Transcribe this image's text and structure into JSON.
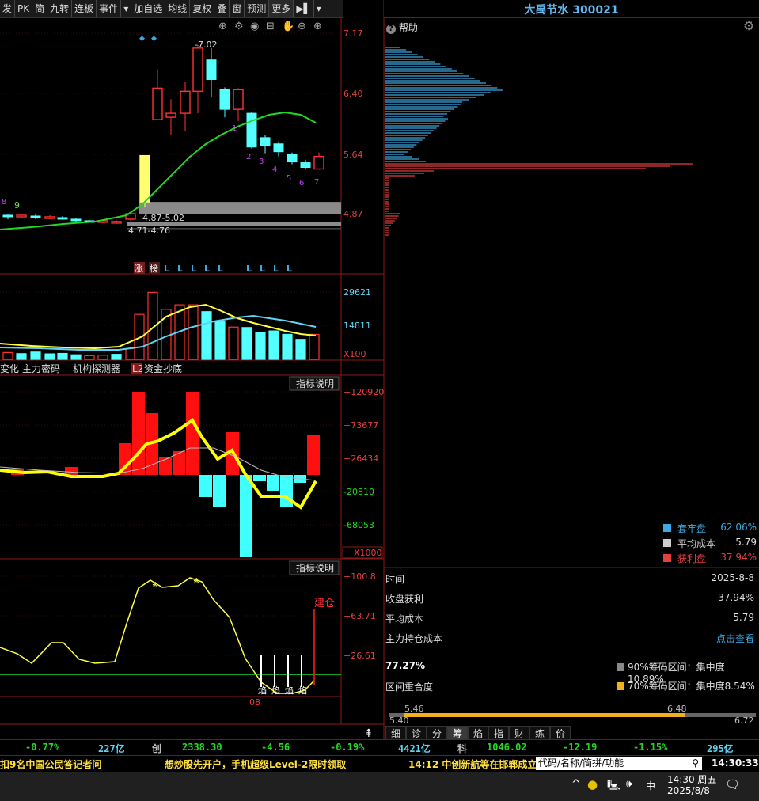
{
  "toolbar": {
    "items": [
      "发",
      "PK",
      "简",
      "九转",
      "连板",
      "事件",
      "▾",
      "加自选",
      "均线",
      "复权",
      "叠",
      "窗",
      "预测",
      "更多",
      "▶▌",
      "▾"
    ]
  },
  "stock": {
    "title": "大禹节水 300021",
    "help": "帮助"
  },
  "price_panel": {
    "y_ticks": [
      "7.17",
      "6.40",
      "5.64",
      "4.87"
    ],
    "high_label": "7.02",
    "zone1": "4.87-5.02",
    "zone2": "4.71-4.76",
    "counts": [
      "1",
      "2",
      "3",
      "4",
      "5",
      "6",
      "7"
    ],
    "left_labels": [
      "8",
      "9"
    ],
    "events": [
      "涨",
      "榜",
      "L",
      "L",
      "L",
      "L",
      "L",
      "L",
      "L",
      "L",
      "L"
    ]
  },
  "volume_panel": {
    "y_ticks": [
      "29621",
      "14811"
    ],
    "unit": "X100"
  },
  "indicator_tabs": [
    "变化",
    "主力密码",
    "机构探测器",
    "L2",
    "资金抄底"
  ],
  "macd_panel": {
    "button": "指标说明",
    "y_ticks": [
      "+120920",
      "+73677",
      "+26434",
      "-20810",
      "-68053"
    ],
    "unit": "X1000"
  },
  "osc_panel": {
    "button": "指标说明",
    "y_ticks": [
      "+100.8",
      "+63.71",
      "+26.61"
    ],
    "label": "建仓",
    "glyph": "焰",
    "date": "08"
  },
  "chip_dist": {
    "legend": [
      {
        "name": "套牢盘",
        "value": "62.06%",
        "color": "#3fa8e0"
      },
      {
        "name": "平均成本",
        "value": "5.79",
        "color": "#cccccc"
      },
      {
        "name": "获利盘",
        "value": "37.94%",
        "color": "#e34040"
      }
    ]
  },
  "info": {
    "rows": [
      {
        "k": "时间",
        "v": "2025-8-8"
      },
      {
        "k": "收盘获利",
        "v": "37.94%"
      },
      {
        "k": "平均成本",
        "v": "5.79"
      },
      {
        "k": "主力持仓成本",
        "v": "点击查看"
      }
    ],
    "pct": "77.27%",
    "overlap": "区间重合度",
    "c90": "90%筹码区间：集中度10.89%",
    "c70": "70%筹码区间：集中度8.54%",
    "range_top_l": "5.46",
    "range_top_r": "6.48",
    "range_bot_l": "5.40",
    "range_bot_r": "6.72"
  },
  "bottom_tabs": [
    "细",
    "诊",
    "分",
    "筹",
    "焰",
    "指",
    "财",
    "练",
    "价"
  ],
  "ticker": {
    "items": [
      "-0.77%",
      "227亿",
      "创",
      "2338.30",
      "-4.56",
      "-0.19%",
      "4421亿",
      "科",
      "1046.02",
      "-12.19",
      "-1.15%",
      "295亿"
    ]
  },
  "news": {
    "items": [
      "扣9名中国公民答记者问",
      "想炒股先开户，手机超级Level-2限时领取",
      "14:12 中创新航等在邯郸成立"
    ],
    "search_placeholder": "代码/名称/简拼/功能",
    "time": "14:30:33"
  },
  "taskbar": {
    "ime": "中",
    "time": "14:30 周五",
    "date": "2025/8/8"
  }
}
